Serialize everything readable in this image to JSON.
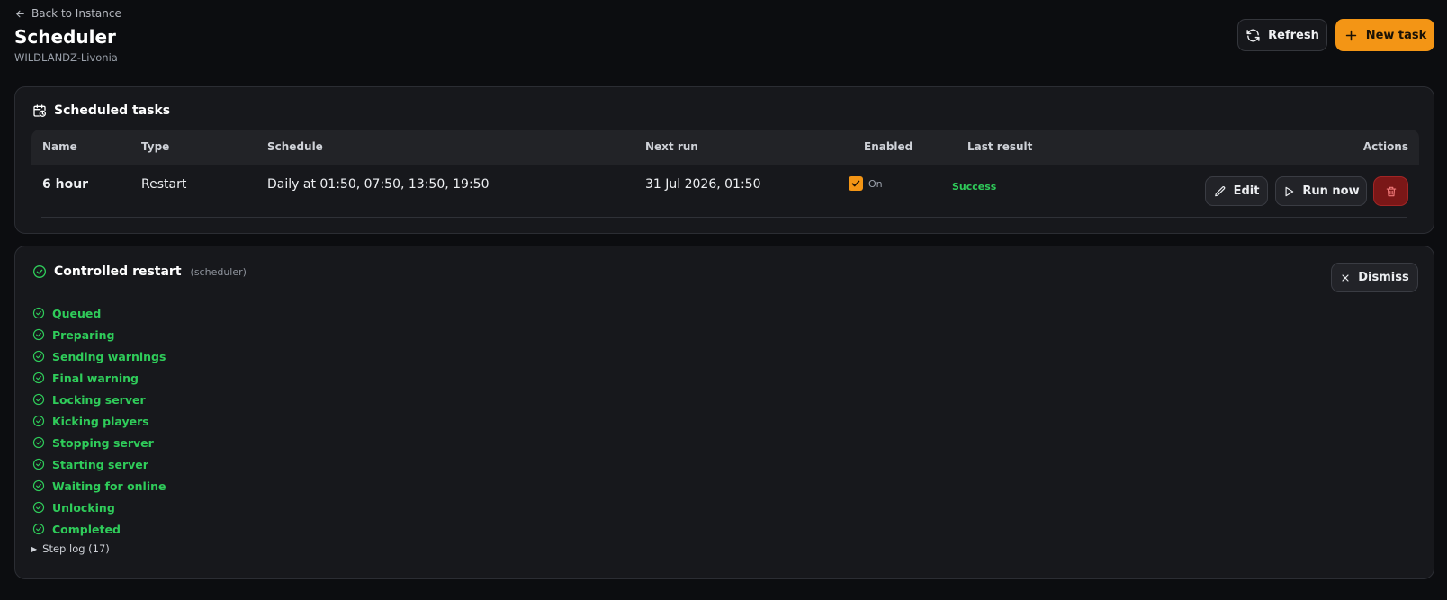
{
  "header": {
    "back_label": "Back to Instance",
    "title": "Scheduler",
    "subtitle": "WILDLANDZ-Livonia",
    "refresh_label": "Refresh",
    "new_task_label": "New task"
  },
  "colors": {
    "background": "#0c0d10",
    "card": "#17181c",
    "accent": "#f39515",
    "success": "#2fcc5a",
    "danger": "#7a1717"
  },
  "tasks_card": {
    "title": "Scheduled tasks",
    "columns": [
      "Name",
      "Type",
      "Schedule",
      "Next run",
      "Enabled",
      "Last result",
      "Actions"
    ],
    "rows": [
      {
        "name": "6 hour",
        "type": "Restart",
        "schedule": "Daily at 01:50, 07:50, 13:50, 19:50",
        "next_run": "31 Jul 2026, 01:50",
        "enabled": true,
        "enabled_label": "On",
        "last_result": "Success",
        "edit_label": "Edit",
        "run_label": "Run now"
      }
    ]
  },
  "restart_card": {
    "title": "Controlled restart",
    "source": "(scheduler)",
    "dismiss_label": "Dismiss",
    "steps": [
      "Queued",
      "Preparing",
      "Sending warnings",
      "Final warning",
      "Locking server",
      "Kicking players",
      "Stopping server",
      "Starting server",
      "Waiting for online",
      "Unlocking",
      "Completed"
    ],
    "step_log_label": "Step log (17)"
  },
  "icons": {
    "back": "arrow-left-icon",
    "refresh": "refresh-icon",
    "new": "plus-icon",
    "tasks": "calendar-clock-icon",
    "edit": "pencil-icon",
    "run": "play-icon",
    "delete": "trash-icon",
    "restart_status": "check-circle-icon",
    "dismiss": "close-icon"
  }
}
